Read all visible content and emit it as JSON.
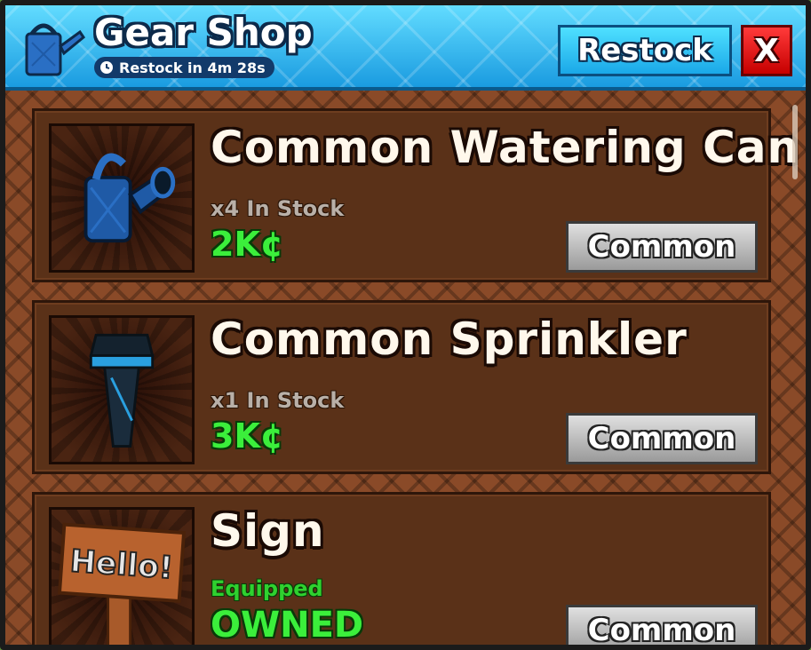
{
  "header": {
    "title": "Gear Shop",
    "restock_timer": "Restock in 4m 28s",
    "restock_button": "Restock",
    "close_button": "X"
  },
  "items": [
    {
      "name": "Common Watering Can",
      "stock": "x4 In Stock",
      "price": "2K¢",
      "rarity": "Common",
      "icon": "watering-can-icon"
    },
    {
      "name": "Common Sprinkler",
      "stock": "x1 In Stock",
      "price": "3K¢",
      "rarity": "Common",
      "icon": "sprinkler-icon"
    },
    {
      "name": "Sign",
      "status": "Equipped",
      "price": "OWNED",
      "rarity": "Common",
      "icon": "sign-icon",
      "sign_text": "Hello!"
    }
  ],
  "colors": {
    "header_blue": "#1ea2e6",
    "price_green": "#3bef3b",
    "close_red": "#c60000",
    "card_brown": "#5a3118"
  }
}
